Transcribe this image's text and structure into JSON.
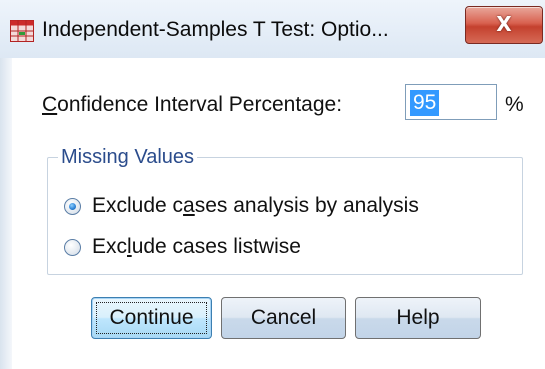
{
  "window": {
    "title": "Independent-Samples T Test: Optio...",
    "close_label": "X"
  },
  "confidence": {
    "label_accel": "C",
    "label_rest": "onfidence Interval Percentage:",
    "value": "95",
    "percent_sign": "%"
  },
  "missing_values": {
    "legend": "Missing Values",
    "options": [
      {
        "pre": "Exclude c",
        "accel": "a",
        "post": "ses analysis by analysis",
        "selected": true
      },
      {
        "pre": "Exc",
        "accel": "l",
        "post": "ude cases listwise",
        "selected": false
      }
    ]
  },
  "buttons": {
    "continue": "Continue",
    "cancel": "Cancel",
    "help": "Help"
  },
  "colors": {
    "selection_highlight": "#3399ff",
    "group_legend": "#2b4c8c",
    "close_button": "#c4412e"
  },
  "icons": {
    "app_icon": "spss-table-icon",
    "close": "close-icon"
  }
}
